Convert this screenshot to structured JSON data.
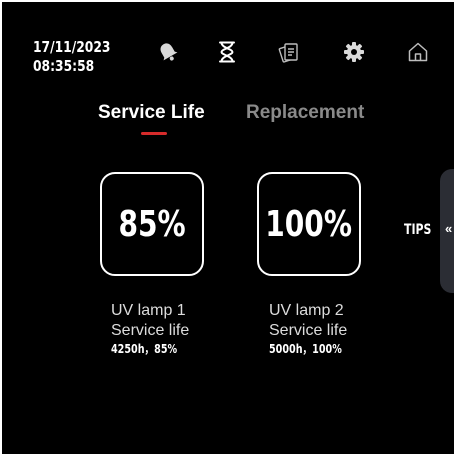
{
  "header": {
    "date": "17/11/2023",
    "time": "08:35:58"
  },
  "toolbar": {
    "icons": [
      "bell-icon",
      "hourglass-icon",
      "documents-icon",
      "gear-icon",
      "home-icon"
    ],
    "active_icon": "hourglass-icon"
  },
  "tabs": [
    {
      "label": "Service Life",
      "active": true
    },
    {
      "label": "Replacement",
      "active": false
    }
  ],
  "lamps": [
    {
      "value": "85%",
      "name": "UV lamp 1",
      "caption": "Service life",
      "detail": "4250h，85%",
      "percent": 85
    },
    {
      "value": "100%",
      "name": "UV lamp 2",
      "caption": "Service life",
      "detail": "5000h，100%",
      "percent": 100
    }
  ],
  "tips": {
    "label": "TIPS",
    "arrow": "«"
  },
  "colors": {
    "background": "#000000",
    "accent": "#d62b2b",
    "inactive_tab": "#8a8a8a",
    "panel": "#2b2d34"
  }
}
